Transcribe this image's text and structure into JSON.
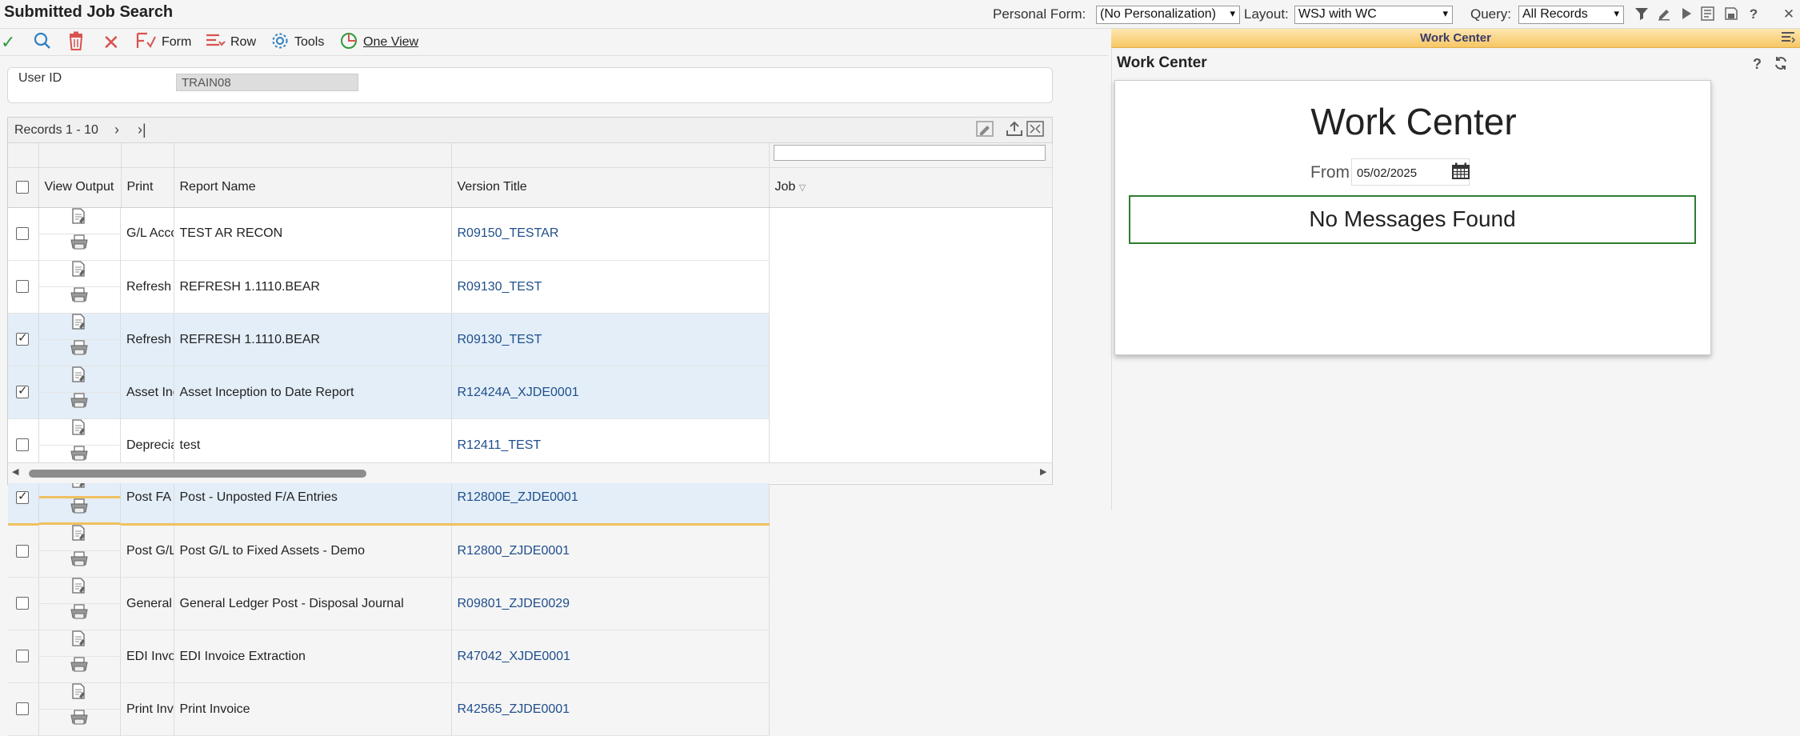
{
  "header": {
    "title": "Submitted Job Search",
    "personal_form_label": "Personal Form:",
    "personal_form_value": "(No Personalization)",
    "layout_label": "Layout:",
    "layout_value": "WSJ with WC",
    "query_label": "Query:",
    "query_value": "All Records",
    "icons": [
      "filter-icon",
      "pencil-icon",
      "play-icon",
      "list-icon",
      "save-icon",
      "help-icon",
      "close-icon"
    ]
  },
  "toolbar": {
    "ok_icon": "check-icon",
    "find_icon": "search-icon",
    "delete_icon": "trash-icon",
    "cancel_icon": "close-x-icon",
    "form_label": "Form",
    "row_label": "Row",
    "tools_label": "Tools",
    "oneview_label": "One View"
  },
  "user": {
    "label": "User ID",
    "value": "TRAIN08"
  },
  "grid": {
    "records_label": "Records 1 - 10",
    "columns": [
      "View Output",
      "Print",
      "Report Name",
      "Version Title",
      "Job"
    ],
    "rows": [
      {
        "checked": false,
        "report": "G/L Account Reconciliation",
        "version": "TEST AR RECON",
        "job": "R09150_TESTAR"
      },
      {
        "checked": false,
        "report": "Refresh Reconciliation File",
        "version": "REFRESH 1.1110.BEAR",
        "job": "R09130_TEST"
      },
      {
        "checked": true,
        "report": "Refresh Reconciliation File",
        "version": "REFRESH 1.1110.BEAR",
        "job": "R09130_TEST"
      },
      {
        "checked": true,
        "report": "Asset Inception to Date Balances Report",
        "version": "Asset Inception to Date Report",
        "job": "R12424A_XJDE0001"
      },
      {
        "checked": false,
        "report": "Depreciation Schedule",
        "version": "test",
        "job": "R12411_TEST"
      },
      {
        "checked": true,
        "report": "Post FA Detail Error Report",
        "version": "Post - Unposted F/A Entries",
        "job": "R12800E_ZJDE0001"
      },
      {
        "checked": false,
        "report": "Post G/L Entries to Assets",
        "version": "Post G/L to Fixed Assets - Demo",
        "job": "R12800_ZJDE0001"
      },
      {
        "checked": false,
        "report": "General Ledger Post",
        "version": "General Ledger Post - Disposal Journal",
        "job": "R09801_ZJDE0029"
      },
      {
        "checked": false,
        "report": "EDI Invoice Extraction",
        "version": "EDI Invoice Extraction",
        "job": "R47042_XJDE0001"
      },
      {
        "checked": false,
        "report": "Print Invoices",
        "version": "Print Invoice",
        "job": "R42565_ZJDE0001"
      }
    ]
  },
  "work_center": {
    "strip_title": "Work Center",
    "pane_title": "Work Center",
    "card_title": "Work Center",
    "from_label": "From",
    "from_date": "05/02/2025",
    "message": "No Messages Found"
  },
  "colors": {
    "selected_row": "#e3eef8",
    "link": "#1f4e8c",
    "strip_gold": "#f7c663",
    "message_border": "#2e7d32"
  }
}
